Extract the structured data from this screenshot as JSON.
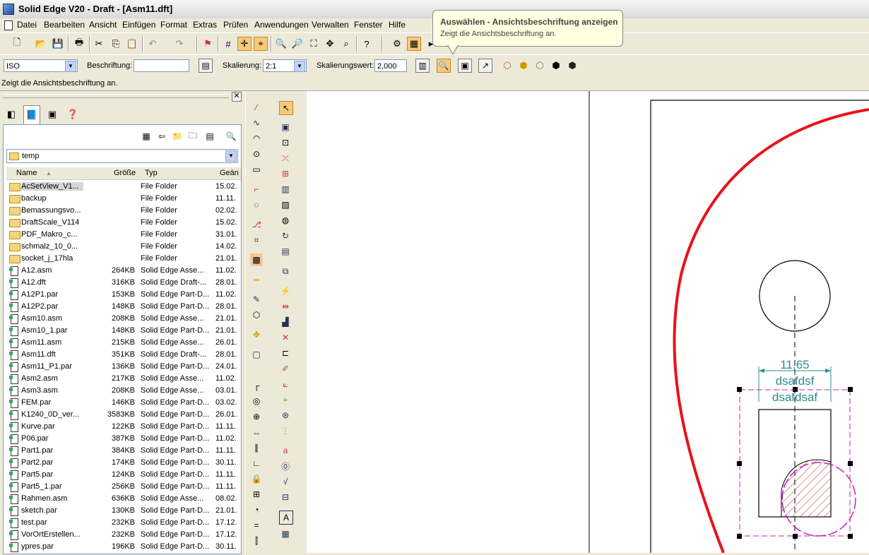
{
  "window": {
    "title": "Solid Edge V20 - Draft - [Asm11.dft]"
  },
  "menu": [
    "Datei",
    "Bearbeiten",
    "Ansicht",
    "Einfügen",
    "Format",
    "Extras",
    "Prüfen",
    "Anwendungen",
    "Verwalten",
    "Fenster",
    "Hilfe"
  ],
  "tooltip": {
    "title": "Auswählen - Ansichtsbeschriftung anzeigen",
    "description": "Zeigt die Ansichtsbeschriftung an."
  },
  "ribbon": {
    "standard": "ISO",
    "beschriftung_label": "Beschriftung:",
    "beschriftung_value": "",
    "skalierung_label": "Skalierung:",
    "skalierung_value": "2:1",
    "skalierungswert_label": "Skalierungswert:",
    "skalierungswert_value": "2,000"
  },
  "status": "Zeigt die Ansichtsbeschriftung an.",
  "library": {
    "folder": "temp",
    "columns": [
      "Name",
      "Größe",
      "Typ",
      "Geän"
    ],
    "files": [
      {
        "name": "AcSetView_V1...",
        "size": "",
        "type": "File Folder",
        "date": "15.02.",
        "kind": "folder"
      },
      {
        "name": "backup",
        "size": "",
        "type": "File Folder",
        "date": "11.11.",
        "kind": "folder"
      },
      {
        "name": "Bemassungsvo...",
        "size": "",
        "type": "File Folder",
        "date": "02.02.",
        "kind": "folder"
      },
      {
        "name": "DraftScale_V114",
        "size": "",
        "type": "File Folder",
        "date": "15.02.",
        "kind": "folder"
      },
      {
        "name": "PDF_Makro_c...",
        "size": "",
        "type": "File Folder",
        "date": "31.01.",
        "kind": "folder"
      },
      {
        "name": "schmalz_10_0...",
        "size": "",
        "type": "File Folder",
        "date": "14.02.",
        "kind": "folder"
      },
      {
        "name": "socket_j_17hla",
        "size": "",
        "type": "File Folder",
        "date": "21.01.",
        "kind": "folder"
      },
      {
        "name": "A12.asm",
        "size": "264KB",
        "type": "Solid Edge Asse...",
        "date": "11.02.",
        "kind": "file"
      },
      {
        "name": "A12.dft",
        "size": "316KB",
        "type": "Solid Edge Draft-...",
        "date": "28.01.",
        "kind": "file"
      },
      {
        "name": "A12P1.par",
        "size": "153KB",
        "type": "Solid Edge Part-D...",
        "date": "11.02.",
        "kind": "file"
      },
      {
        "name": "A12P2.par",
        "size": "148KB",
        "type": "Solid Edge Part-D...",
        "date": "28.01.",
        "kind": "file"
      },
      {
        "name": "Asm10.asm",
        "size": "208KB",
        "type": "Solid Edge Asse...",
        "date": "21.01.",
        "kind": "file"
      },
      {
        "name": "Asm10_1.par",
        "size": "148KB",
        "type": "Solid Edge Part-D...",
        "date": "21.01.",
        "kind": "file"
      },
      {
        "name": "Asm11.asm",
        "size": "215KB",
        "type": "Solid Edge Asse...",
        "date": "26.01.",
        "kind": "file"
      },
      {
        "name": "Asm11.dft",
        "size": "351KB",
        "type": "Solid Edge Draft-...",
        "date": "28.01.",
        "kind": "file"
      },
      {
        "name": "Asm11_P1.par",
        "size": "136KB",
        "type": "Solid Edge Part-D...",
        "date": "24.01.",
        "kind": "file"
      },
      {
        "name": "Asm2.asm",
        "size": "217KB",
        "type": "Solid Edge Asse...",
        "date": "11.02.",
        "kind": "file"
      },
      {
        "name": "Asm3.asm",
        "size": "208KB",
        "type": "Solid Edge Asse...",
        "date": "03.01.",
        "kind": "file"
      },
      {
        "name": "FEM.par",
        "size": "146KB",
        "type": "Solid Edge Part-D...",
        "date": "03.02.",
        "kind": "file"
      },
      {
        "name": "K1240_0D_ver...",
        "size": "3583KB",
        "type": "Solid Edge Part-D...",
        "date": "26.01.",
        "kind": "file"
      },
      {
        "name": "Kurve.par",
        "size": "122KB",
        "type": "Solid Edge Part-D...",
        "date": "11.11.",
        "kind": "file"
      },
      {
        "name": "P06.par",
        "size": "387KB",
        "type": "Solid Edge Part-D...",
        "date": "11.02.",
        "kind": "file"
      },
      {
        "name": "Part1.par",
        "size": "384KB",
        "type": "Solid Edge Part-D...",
        "date": "11.11.",
        "kind": "file"
      },
      {
        "name": "Part2.par",
        "size": "174KB",
        "type": "Solid Edge Part-D...",
        "date": "30.11.",
        "kind": "file"
      },
      {
        "name": "Part5.par",
        "size": "124KB",
        "type": "Solid Edge Part-D...",
        "date": "11.11.",
        "kind": "file"
      },
      {
        "name": "Part5_1.par",
        "size": "256KB",
        "type": "Solid Edge Part-D...",
        "date": "11.11.",
        "kind": "file"
      },
      {
        "name": "Rahmen.asm",
        "size": "636KB",
        "type": "Solid Edge Asse...",
        "date": "08.02.",
        "kind": "file"
      },
      {
        "name": "sketch.par",
        "size": "130KB",
        "type": "Solid Edge Part-D...",
        "date": "21.01.",
        "kind": "file"
      },
      {
        "name": "test.par",
        "size": "232KB",
        "type": "Solid Edge Part-D...",
        "date": "17.12.",
        "kind": "file"
      },
      {
        "name": "VorOrtErstellen...",
        "size": "232KB",
        "type": "Solid Edge Part-D...",
        "date": "17.12.",
        "kind": "file"
      },
      {
        "name": "ypres.par",
        "size": "196KB",
        "type": "Solid Edge Part-D...",
        "date": "30.11.",
        "kind": "file"
      }
    ]
  },
  "drawing": {
    "dimension": "11,65",
    "caption_line1": "dsafdsf",
    "caption_line2": "dsafdsaf"
  },
  "colors": {
    "accent_red": "#e8121b",
    "dim_teal": "#2d8b8b",
    "select_magenta": "#c020c0"
  }
}
